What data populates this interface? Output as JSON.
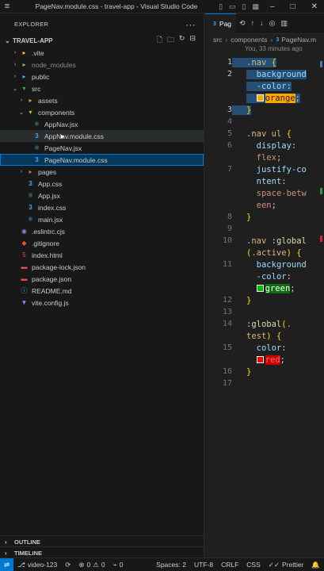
{
  "window": {
    "title": "PageNav.module.css - travel-app - Visual Studio Code"
  },
  "sidebar": {
    "title": "EXPLORER",
    "folder": "TRAVEL-APP",
    "tree": [
      {
        "label": ".vite",
        "icon": "vite-folder-icon",
        "glyph": "▶",
        "depth": 1,
        "kind": "folder"
      },
      {
        "label": "node_modules",
        "icon": "node-folder-icon",
        "glyph": "▶",
        "depth": 1,
        "kind": "folder",
        "dim": true
      },
      {
        "label": "public",
        "icon": "public-folder-icon",
        "glyph": "▶",
        "depth": 1,
        "kind": "folder"
      },
      {
        "label": "src",
        "icon": "src-folder-icon",
        "glyph": "▼",
        "depth": 1,
        "kind": "folder"
      },
      {
        "label": "assets",
        "icon": "assets-folder-icon",
        "glyph": "▶",
        "depth": 2,
        "kind": "folder"
      },
      {
        "label": "components",
        "icon": "components-folder-icon",
        "glyph": "▼",
        "depth": 2,
        "kind": "folder"
      },
      {
        "label": "AppNav.jsx",
        "icon": "react-icon",
        "depth": 3,
        "kind": "file"
      },
      {
        "label": "AppNav.module.css",
        "icon": "css-icon",
        "depth": 3,
        "kind": "file",
        "hover": true
      },
      {
        "label": "PageNav.jsx",
        "icon": "react-icon",
        "depth": 3,
        "kind": "file"
      },
      {
        "label": "PageNav.module.css",
        "icon": "css-icon",
        "depth": 3,
        "kind": "file",
        "selected": true
      },
      {
        "label": "pages",
        "icon": "pages-folder-icon",
        "glyph": "▶",
        "depth": 2,
        "kind": "folder"
      },
      {
        "label": "App.css",
        "icon": "css-icon",
        "depth": 2,
        "kind": "file"
      },
      {
        "label": "App.jsx",
        "icon": "react-icon",
        "depth": 2,
        "kind": "file"
      },
      {
        "label": "index.css",
        "icon": "css-icon",
        "depth": 2,
        "kind": "file"
      },
      {
        "label": "main.jsx",
        "icon": "react-icon",
        "depth": 2,
        "kind": "file"
      },
      {
        "label": ".eslintrc.cjs",
        "icon": "eslint-icon",
        "depth": 1,
        "kind": "file"
      },
      {
        "label": ".gitignore",
        "icon": "git-icon",
        "depth": 1,
        "kind": "file"
      },
      {
        "label": "index.html",
        "icon": "html-icon",
        "depth": 1,
        "kind": "file"
      },
      {
        "label": "package-lock.json",
        "icon": "json-icon",
        "depth": 1,
        "kind": "file"
      },
      {
        "label": "package.json",
        "icon": "json-icon",
        "depth": 1,
        "kind": "file"
      },
      {
        "label": "README.md",
        "icon": "info-icon",
        "depth": 1,
        "kind": "file"
      },
      {
        "label": "vite.config.js",
        "icon": "vite-config-icon",
        "depth": 1,
        "kind": "file"
      }
    ],
    "outline": "OUTLINE",
    "timeline": "TIMELINE"
  },
  "editor": {
    "tab_label": "Pag",
    "breadcrumb": [
      "src",
      "components",
      "PageNav.m"
    ],
    "codelens": "You, 33 minutes ago",
    "color_words": {
      "orange": "orange",
      "green": "green",
      "red": "red"
    }
  },
  "status": {
    "branch": "video-123",
    "errors": "0",
    "warnings": "0",
    "ports": "0",
    "spaces": "Spaces: 2",
    "encoding": "UTF-8",
    "eol": "CRLF",
    "language": "CSS",
    "formatter": "Prettier"
  },
  "colors": {
    "accent": "#0078d4",
    "selection": "#04395e",
    "swatch_orange": "#ffa500",
    "swatch_green": "#00c000",
    "swatch_red": "#ff0000"
  }
}
